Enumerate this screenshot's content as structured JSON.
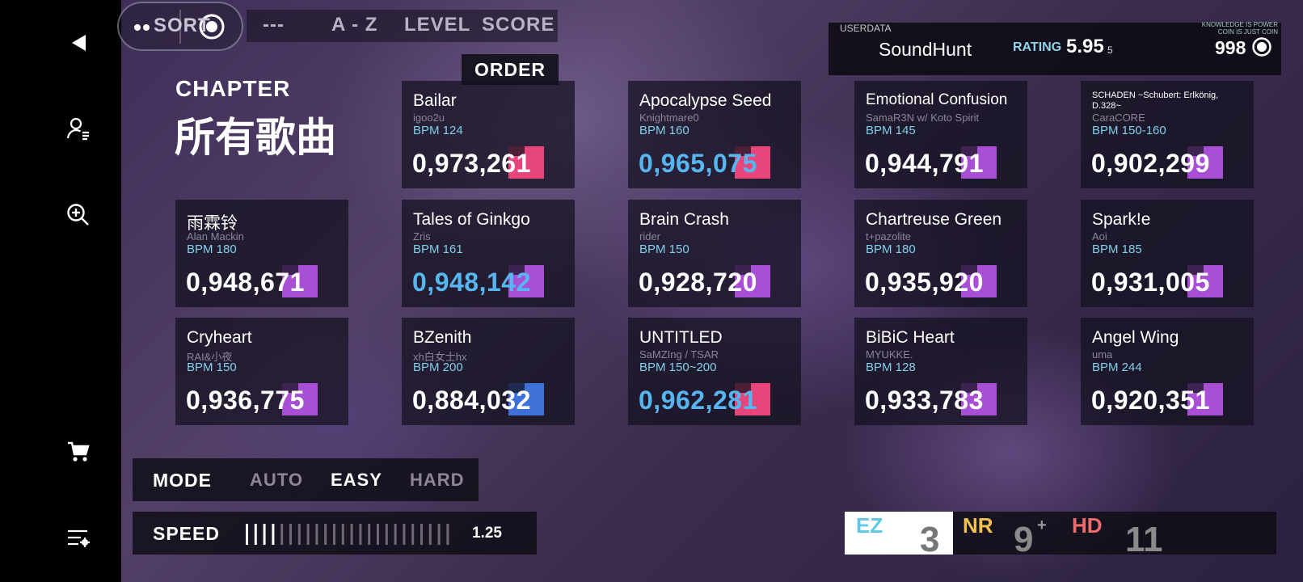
{
  "top": {
    "sort_label": "SORT",
    "tabs": [
      "---",
      "A - Z",
      "LEVEL",
      "SCORE"
    ],
    "order_label": "ORDER"
  },
  "chapter": {
    "label": "CHAPTER",
    "title": "所有歌曲"
  },
  "userdata": {
    "label": "USERDATA",
    "name": "SoundHunt",
    "rating_label": "RATING",
    "rating": "5.95",
    "rating_sub": "5",
    "motto_line1": "KNOWLEDGE IS POWER",
    "motto_line2": "COIN IS JUST COIN",
    "coins": "998"
  },
  "songs": [
    {
      "title": "Bailar",
      "artist": "igoo2u",
      "bpm": "BPM 124",
      "score": "0,973,261",
      "badge_color": "#e8457a",
      "score_blue": false
    },
    {
      "title": "Apocalypse Seed",
      "artist": "Knightmare0",
      "bpm": "BPM 160",
      "score": "0,965,075",
      "badge_color": "#e8457a",
      "score_blue": true
    },
    {
      "title": "Emotional Confusion",
      "artist": "SamaR3N w/ Koto Spirit",
      "bpm": "BPM 145",
      "score": "0,944,791",
      "badge_color": "#a84fd6",
      "score_blue": false
    },
    {
      "title": "SCHADEN ~Schubert: Erlkönig, D.328~",
      "artist": "CaraCORE",
      "bpm": "BPM 150-160",
      "score": "0,902,299",
      "badge_color": "#a84fd6",
      "score_blue": false
    },
    {
      "title": "雨霖铃",
      "artist": "Alan Mackin",
      "bpm": "BPM 180",
      "score": "0,948,671",
      "badge_color": "#a84fd6",
      "score_blue": false
    },
    {
      "title": "Tales of Ginkgo",
      "artist": "Zris",
      "bpm": "BPM 161",
      "score": "0,948,142",
      "badge_color": "#a84fd6",
      "score_blue": true
    },
    {
      "title": "Brain Crash",
      "artist": "rider",
      "bpm": "BPM 150",
      "score": "0,928,720",
      "badge_color": "#a84fd6",
      "score_blue": false
    },
    {
      "title": "Chartreuse Green",
      "artist": "t+pazolite",
      "bpm": "BPM 180",
      "score": "0,935,920",
      "badge_color": "#a84fd6",
      "score_blue": false
    },
    {
      "title": "Spark!e",
      "artist": "Aoi",
      "bpm": "BPM 185",
      "score": "0,931,005",
      "badge_color": "#a84fd6",
      "score_blue": false
    },
    {
      "title": "Cryheart",
      "artist": "RAI&小夜",
      "bpm": "BPM 150",
      "score": "0,936,775",
      "badge_color": "#a84fd6",
      "score_blue": false
    },
    {
      "title": "BZenith",
      "artist": "xh白女士hx",
      "bpm": "BPM 200",
      "score": "0,884,032",
      "badge_color": "#3f72d8",
      "score_blue": false
    },
    {
      "title": "UNTITLED",
      "artist": "SaMZIng / TSAR",
      "bpm": "BPM 150~200",
      "score": "0,962,281",
      "badge_color": "#e8457a",
      "score_blue": true
    },
    {
      "title": "BiBiC Heart",
      "artist": "MYUKKE.",
      "bpm": "BPM 128",
      "score": "0,933,783",
      "badge_color": "#a84fd6",
      "score_blue": false
    },
    {
      "title": "Angel Wing",
      "artist": "uma",
      "bpm": "BPM 244",
      "score": "0,920,351",
      "badge_color": "#a84fd6",
      "score_blue": false
    }
  ],
  "mode": {
    "label": "MODE",
    "options": [
      "AUTO",
      "EASY",
      "HARD"
    ],
    "selected": "EASY"
  },
  "speed": {
    "label": "SPEED",
    "value": "1.25",
    "level_fraction": 0.17
  },
  "difficulty": {
    "ez_label": "EZ",
    "ez_level": "3",
    "nr_label": "NR",
    "nr_level": "9",
    "nr_plus": "+",
    "hd_label": "HD",
    "hd_level": "11",
    "colors": {
      "ez": "#5fc8e8",
      "nr": "#f2c14e",
      "hd": "#f06b6b"
    }
  },
  "icons": [
    "back-arrow-icon",
    "account-icon",
    "search-zoom-icon",
    "cart-icon",
    "settings-list-icon",
    "coin-icon",
    "sort-toggle-icon"
  ]
}
